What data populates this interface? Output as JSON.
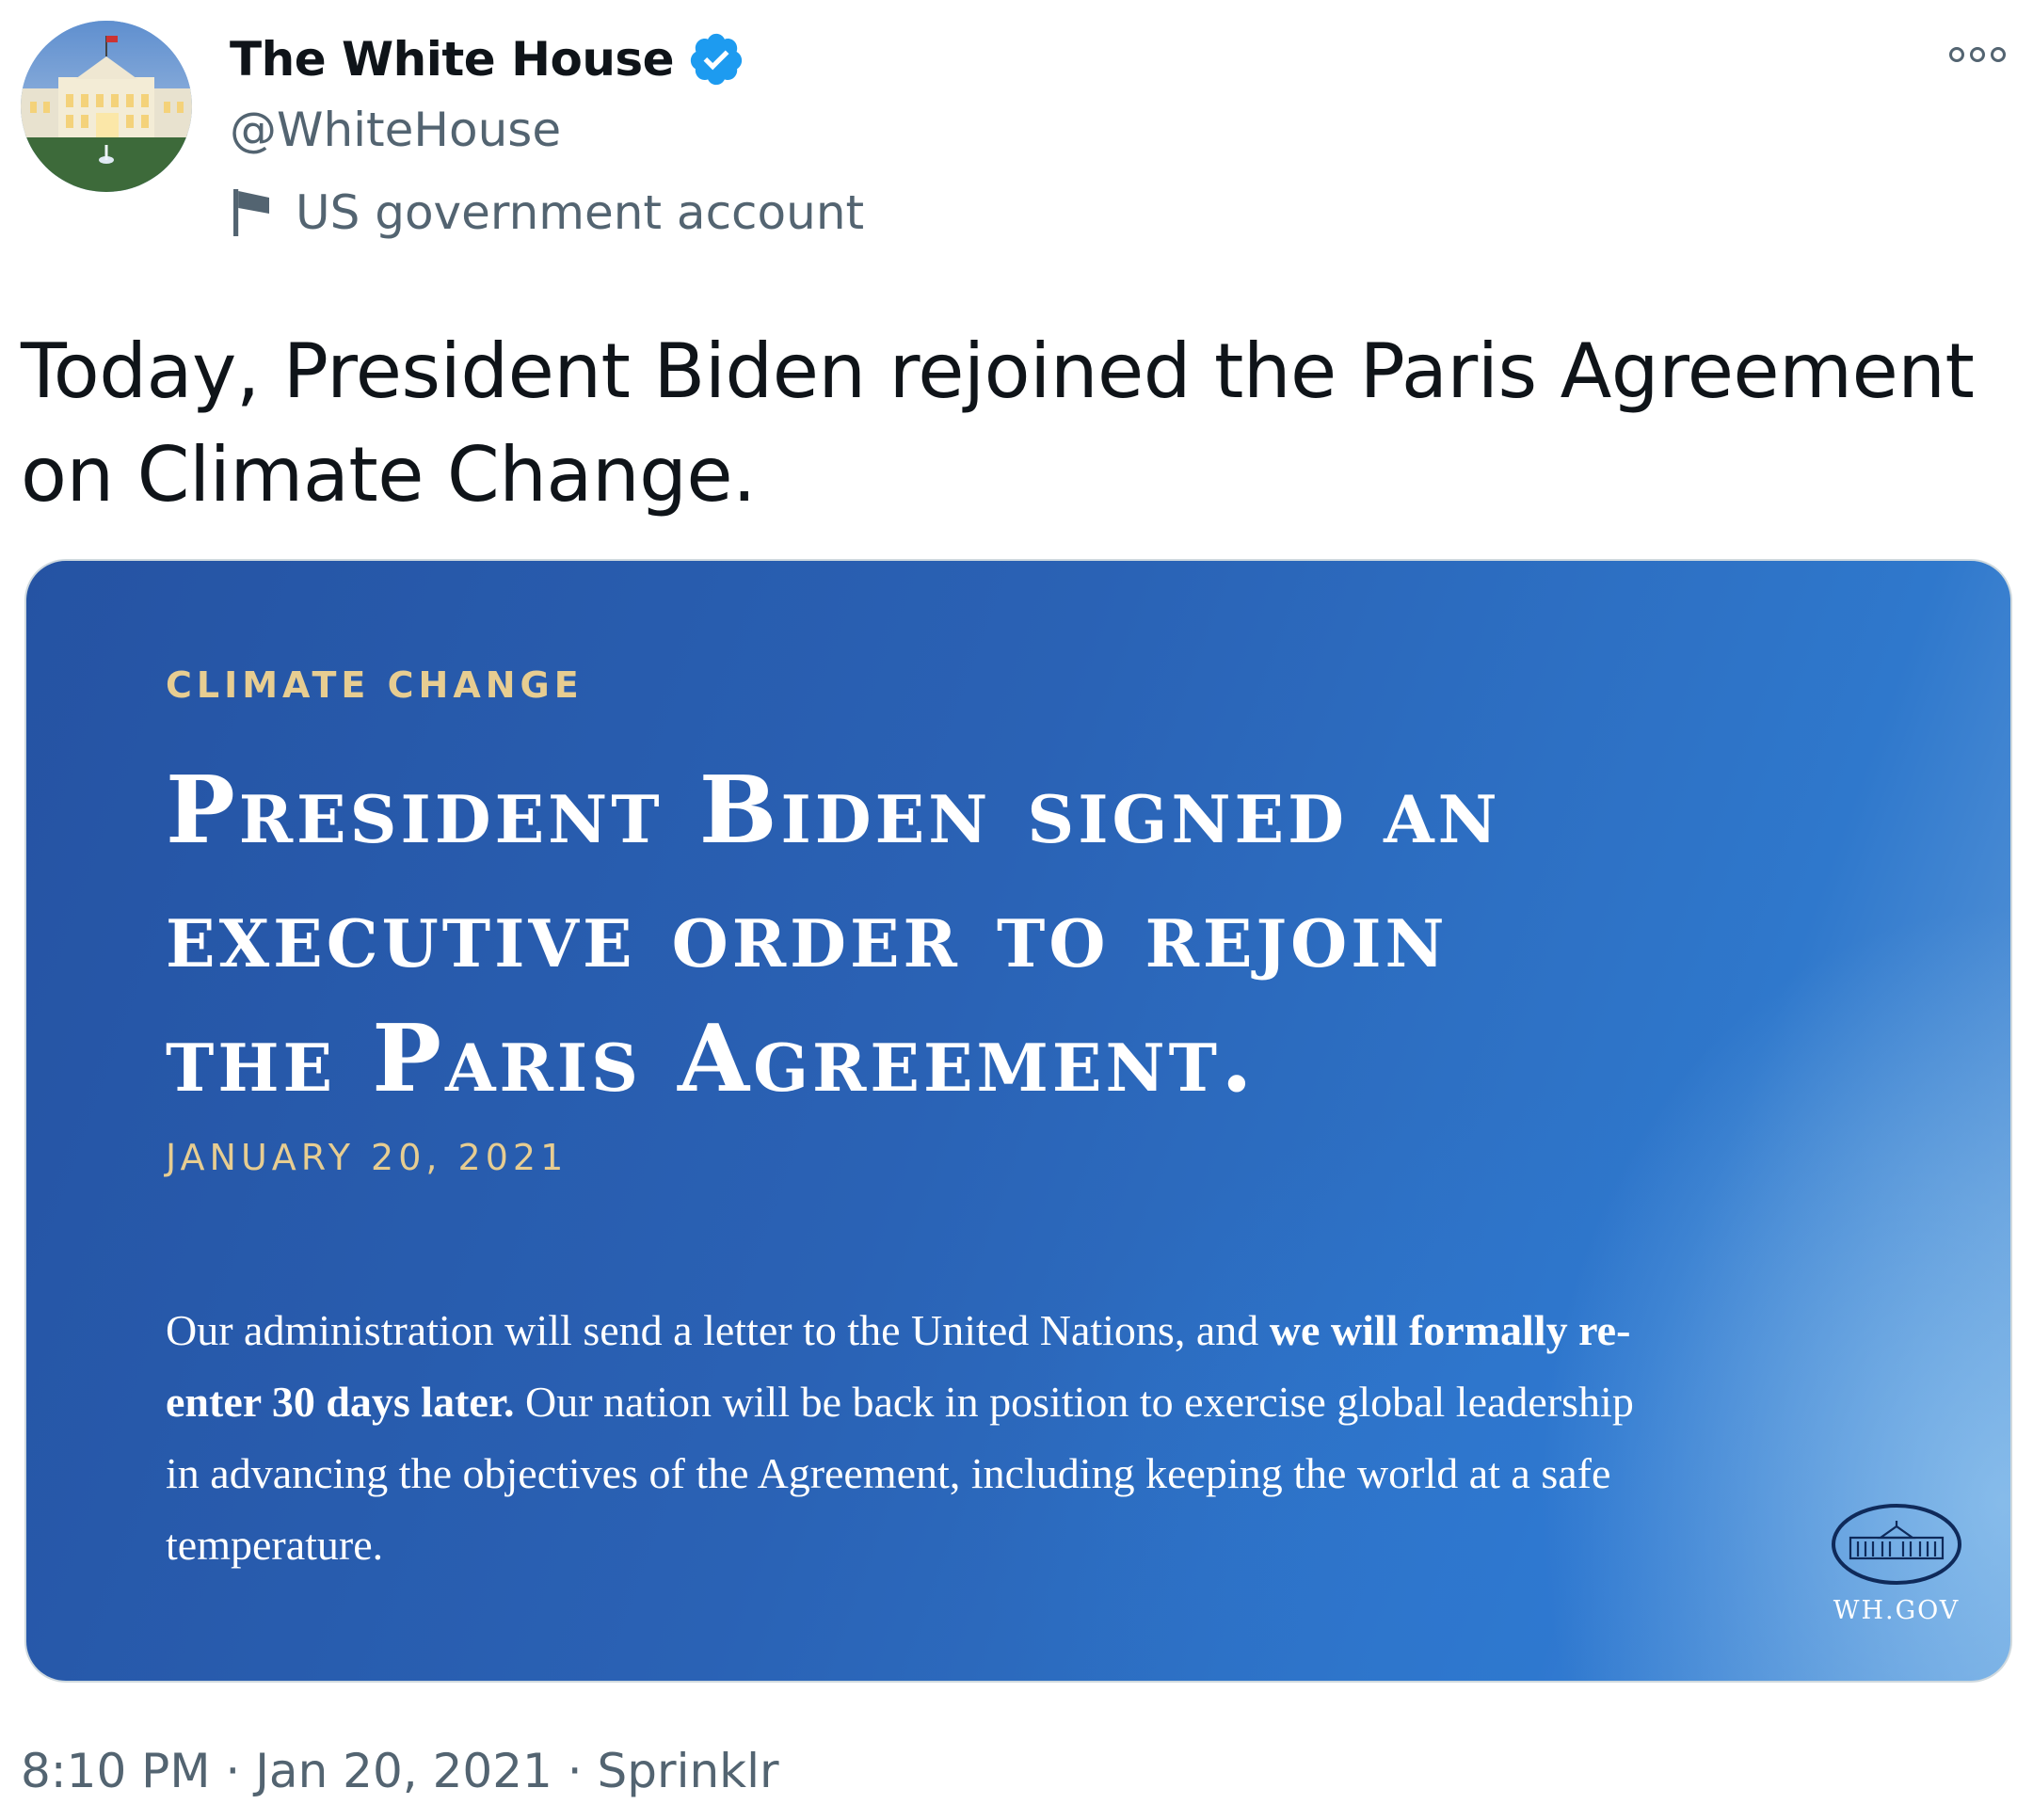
{
  "author": {
    "display_name": "The White House",
    "handle": "@WhiteHouse",
    "verified": true,
    "label": "US government account",
    "avatar_icon": "white-house-photo-icon",
    "label_icon": "flag-icon"
  },
  "tweet": {
    "text": "Today, President Biden rejoined the Paris Agreement on Climate Change.",
    "time": "8:10 PM",
    "date": "Jan 20, 2021",
    "source": "Sprinklr",
    "separator": "·"
  },
  "card": {
    "kicker": "CLIMATE CHANGE",
    "headline_lines": [
      "President Biden signed an",
      "executive order to rejoin",
      "the Paris Agreement."
    ],
    "date": "JANUARY 20, 2021",
    "body_parts": [
      "Our administration will send a letter to the United Nations, and ",
      "we will formally re-enter 30 days later.",
      " Our nation will be back in position to exercise global leadership in advancing the objectives of the Agreement, including keeping the world at a safe temperature."
    ],
    "seal_label": "WH.GOV",
    "colors": {
      "kicker": "#e7cd91",
      "background_start": "#2553a3",
      "background_end": "#6aa3de"
    }
  },
  "colors": {
    "verified_badge": "#1d9bf0",
    "secondary_text": "#536471",
    "primary_text": "#0f1419"
  }
}
